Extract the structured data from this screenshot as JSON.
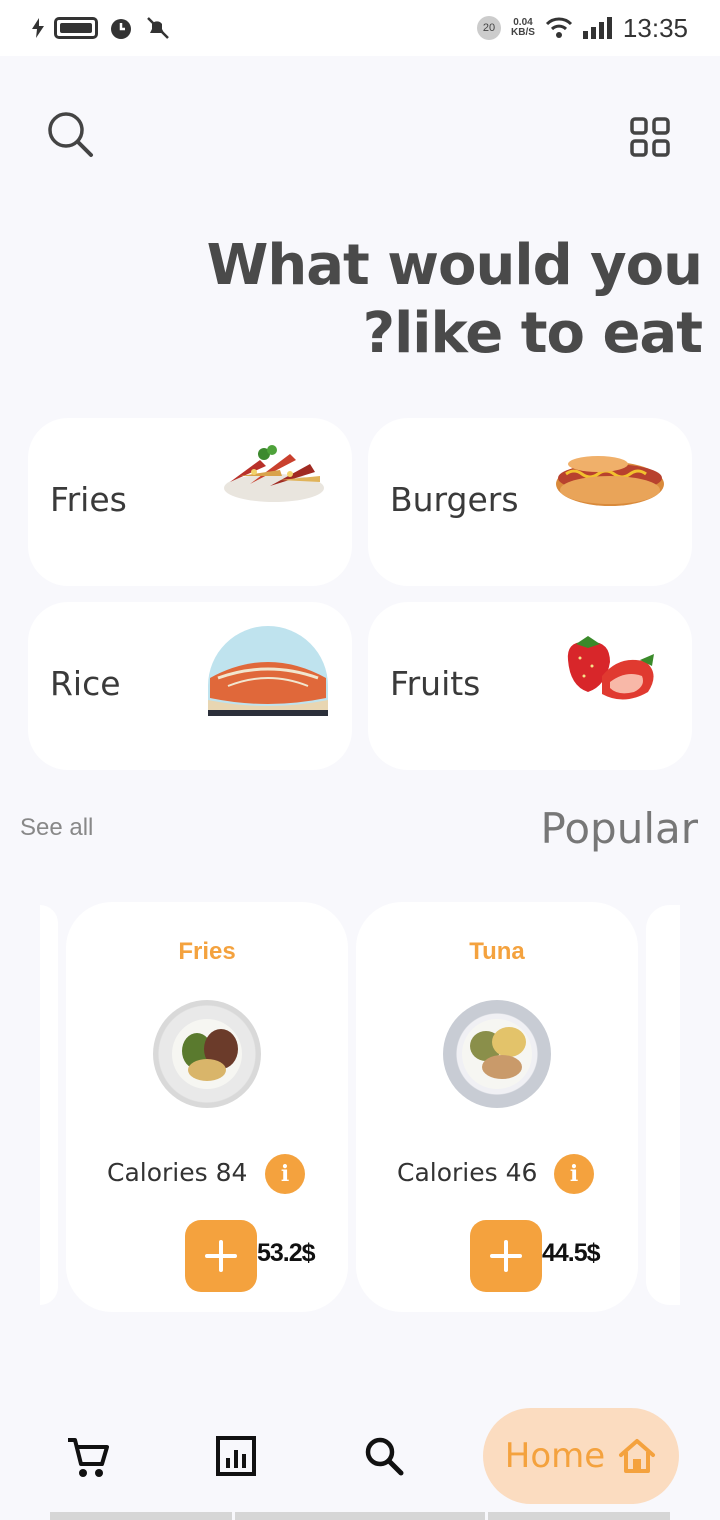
{
  "status": {
    "time": "13:35",
    "badge": "20",
    "net_speed_value": "0.04",
    "net_speed_unit": "KB/S"
  },
  "header": {
    "search_icon": "search-icon",
    "grid_icon": "grid-icon",
    "headline_line1": "What would you",
    "headline_line2": "?like to eat"
  },
  "categories": [
    {
      "label": "Fries",
      "icon": "fries-image"
    },
    {
      "label": "Burgers",
      "icon": "hotdog-image"
    },
    {
      "label": "Rice",
      "icon": "rice-image"
    },
    {
      "label": "Fruits",
      "icon": "strawberry-image"
    }
  ],
  "section": {
    "see_all": "See all",
    "title": "Popular"
  },
  "popular": [
    {
      "name": "Fries",
      "calories": "Calories 84",
      "price": "53.2$"
    },
    {
      "name": "Tuna",
      "calories": "Calories 46",
      "price": "44.5$"
    }
  ],
  "nav": {
    "home_label": "Home",
    "items": [
      "cart-icon",
      "stats-icon",
      "search-icon",
      "home-icon"
    ]
  },
  "colors": {
    "accent": "#f4a23e",
    "accent_soft": "#fbdcc0",
    "background": "#f8f8fc"
  }
}
